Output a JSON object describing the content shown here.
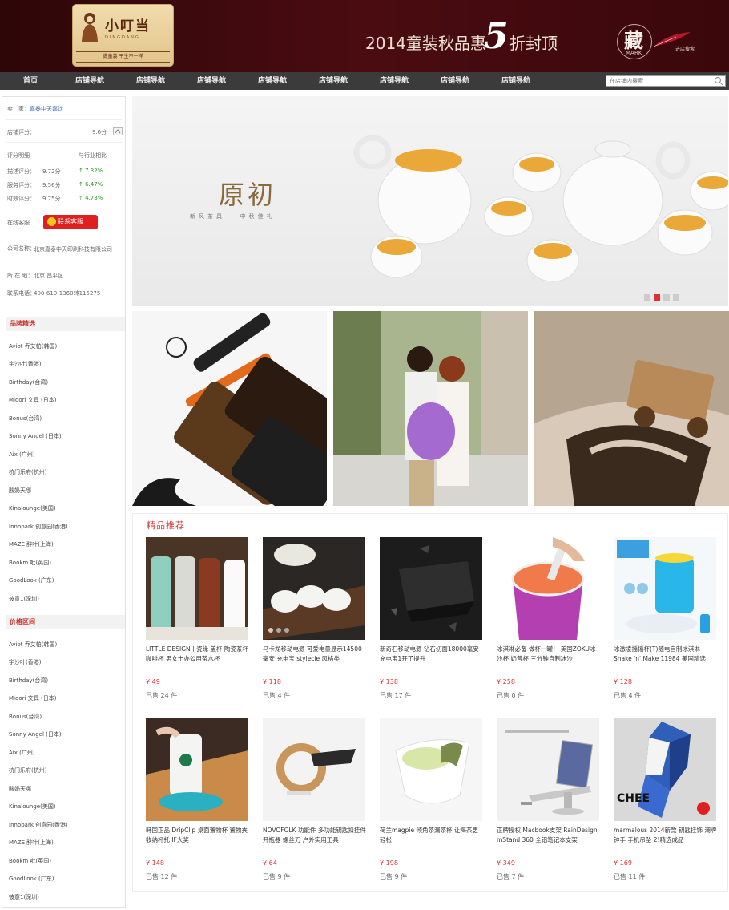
{
  "header": {
    "logo_text": "小叮当",
    "logo_sub": "DINGDANG",
    "logo_tag": "做童装  平生不一样",
    "promo_text": "2014童装秋品惠",
    "promo_big": "5",
    "promo_end": "折封顶",
    "mark_char": "藏",
    "mark_en": "MARK",
    "mark_note": "进店搜索"
  },
  "nav": {
    "items": [
      "首页",
      "店铺导航",
      "店铺导航",
      "店铺导航",
      "店铺导航",
      "店铺导航",
      "店铺导航",
      "店铺导航",
      "店铺导航"
    ],
    "search_placeholder": "在店铺内搜索"
  },
  "sidebar": {
    "breadcrumb_prefix": "卖　家：",
    "breadcrumb_shop": "嘉泰中天嘉饮",
    "score_label": "店铺评分：",
    "score_value": "9.6分",
    "rating_head_1": "评分明细",
    "rating_head_2": "与行业相比",
    "ratings": [
      {
        "label": "描述评分：",
        "score": "9.72分",
        "diff": "7.32%"
      },
      {
        "label": "服务评分：",
        "score": "9.56分",
        "diff": "6.47%"
      },
      {
        "label": "时效评分：",
        "score": "9.75分",
        "diff": "4.73%"
      }
    ],
    "online_label": "在线客服",
    "service_btn": "联系客服",
    "company_label": "公司名称：",
    "company_value": "北京嘉泰中天印刷科技有限公司",
    "location_label": "所 在 地：",
    "location_value": "北京 昌平区",
    "phone_label": "联系电话：",
    "phone_value": "400-610-1360转115275",
    "section1_title": "品牌精选",
    "section2_title": "价格区间",
    "brands": [
      "Aviot 乔艾帕(韩国)",
      "宇沙叶(香港)",
      "Birthday(台湾)",
      "Midori 文具 (日本)",
      "Bonus(台湾)",
      "Sonny Angel (日本)",
      "Aix (广州)",
      "杭门乐府(杭州)",
      "酸奶天哪",
      "Kinalounge(美国)",
      "Innopark 创意园(香港)",
      "MAZE 醉叶(上海)",
      "Bookm 吡(英国)",
      "GoodLook (广东)",
      "彼意1(深圳)"
    ]
  },
  "hero": {
    "title": "原初",
    "subtitle": "新风茶具 · 中秋佳礼"
  },
  "recommend": {
    "title": "精品推荐",
    "products": [
      {
        "name": "LITTLE DESIGN丨瓷缘 盖杯 陶瓷茶杯咖啡杯 男女士办公用茶水杯",
        "price": "¥ 49",
        "sold": "已售 24 件"
      },
      {
        "name": "马卡龙移动电源 可爱电量显示14500毫安 充电宝 stylecie 风格类",
        "price": "¥ 118",
        "sold": "已售 4 件"
      },
      {
        "name": "新奇石移动电源 钻石切面18000毫安 充电宝1开了提升",
        "price": "¥ 138",
        "sold": "已售 17 件"
      },
      {
        "name": "冰淇淋必备  做杯一罐！ 美国ZOKU冰沙杯 奶昔杯 三分钟自制冰沙",
        "price": "¥ 258",
        "sold": "已售 0 件"
      },
      {
        "name": "冰激凌摇摇杯(T)随电自制冰淇淋Shake 'n' Make 11984 美国精选",
        "price": "¥ 128",
        "sold": "已售 4 件"
      },
      {
        "name": "韩国正品 DripClip 桌面置物杯 置物夹 收纳杯托 IF大奖",
        "price": "¥ 148",
        "sold": "已售 12 件"
      },
      {
        "name": "NOVOFOLK 功能件 多功能钥匙扣挂件 开瓶器 螺丝刀 户外实用工具",
        "price": "¥ 64",
        "sold": "已售 9 件"
      },
      {
        "name": "荷兰magpie 倾角茶漏茶杯 让喝茶更轻松",
        "price": "¥ 198",
        "sold": "已售 9 件"
      },
      {
        "name": "正牌授权 Macbook支架 RainDesign mStand 360 全铝笔记本支架",
        "price": "¥ 349",
        "sold": "已售 7 件"
      },
      {
        "name": "marmalous 2014新款 钥匙挂饰 潮牌钟手 手机吊坠 2!精选成品",
        "price": "¥ 169",
        "sold": "已售 11 件"
      }
    ]
  },
  "colors": {
    "banner_bg": "#4a0c11",
    "nav_bg": "#3b3b3b",
    "accent_red": "#e02020",
    "price_red": "#e03030",
    "link_blue": "#3a6bb0",
    "up_green": "#2a9a2a"
  }
}
